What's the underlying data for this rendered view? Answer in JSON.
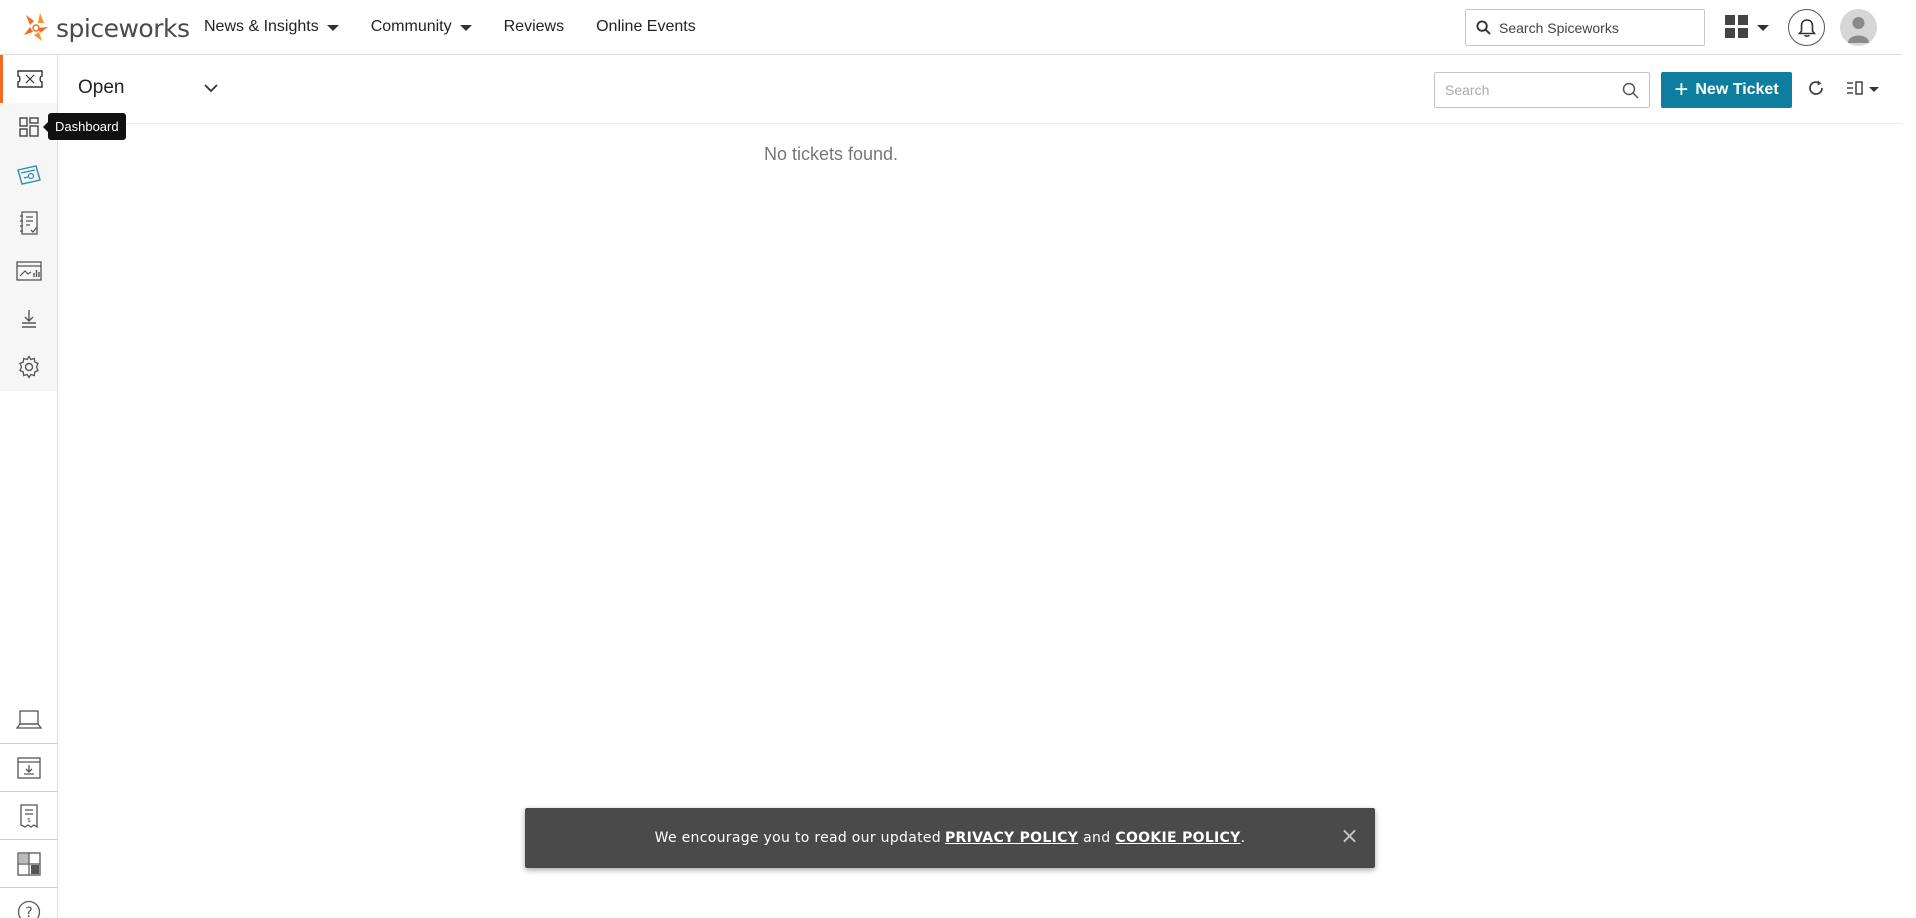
{
  "brand": {
    "name": "spiceworks",
    "accent": "#f26b21"
  },
  "nav": {
    "items": [
      {
        "label": "News & Insights",
        "dropdown": true
      },
      {
        "label": "Community",
        "dropdown": true
      },
      {
        "label": "Reviews",
        "dropdown": false
      },
      {
        "label": "Online Events",
        "dropdown": false
      }
    ],
    "search_placeholder": "Search Spiceworks"
  },
  "sidebar": {
    "top_items": [
      {
        "icon": "ticket-icon",
        "active": true
      },
      {
        "icon": "dashboard-icon",
        "tooltip": "Dashboard"
      },
      {
        "icon": "tickets-tag-icon"
      },
      {
        "icon": "checklist-icon"
      },
      {
        "icon": "reports-icon"
      },
      {
        "icon": "download-icon"
      },
      {
        "icon": "gear-icon"
      }
    ],
    "bottom_items": [
      {
        "icon": "laptop-icon"
      },
      {
        "icon": "inbox-download-icon"
      },
      {
        "icon": "invoice-icon"
      },
      {
        "icon": "layout-icon"
      },
      {
        "icon": "help-icon"
      }
    ],
    "tooltip": "Dashboard"
  },
  "toolbar": {
    "view_label": "Open",
    "search_placeholder": "Search",
    "new_ticket_label": "New Ticket",
    "button_color": "#0e7ea0"
  },
  "main": {
    "empty_message": "No tickets found."
  },
  "banner": {
    "text_before": "We encourage you to read our updated",
    "privacy_link": "PRIVACY POLICY",
    "and_text": "and",
    "cookie_link": "COOKIE POLICY",
    "period": ".",
    "close_label": "×"
  }
}
